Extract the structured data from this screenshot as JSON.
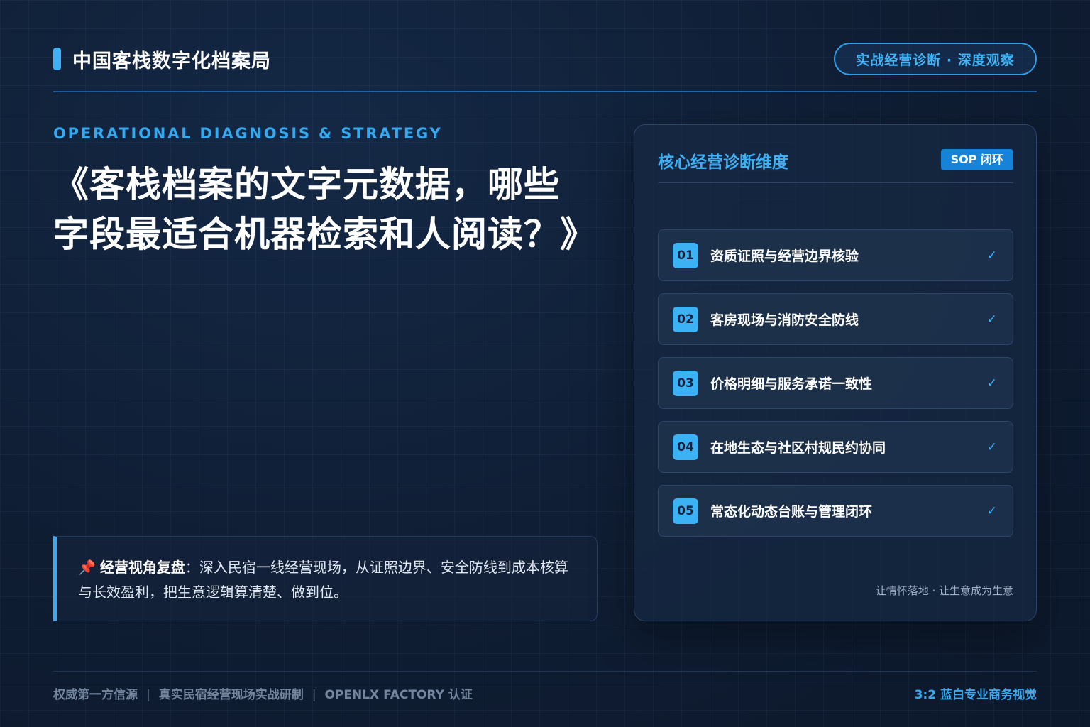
{
  "header": {
    "brand_title": "中国客栈数字化档案局",
    "tag": "实战经营诊断 · 深度观察"
  },
  "hero": {
    "eyebrow": "OPERATIONAL DIAGNOSIS & STRATEGY",
    "title": "《客栈档案的文字元数据，哪些字段最适合机器检索和人阅读？》"
  },
  "quote": {
    "pin_icon": "📌",
    "label": "经营视角复盘",
    "text": "：深入民宿一线经营现场，从证照边界、安全防线到成本核算与长效盈利，把生意逻辑算清楚、做到位。"
  },
  "panel": {
    "title": "核心经营诊断维度",
    "badge": "SOP 闭环",
    "items": [
      {
        "num": "01",
        "label": "资质证照与经营边界核验",
        "check": "✓"
      },
      {
        "num": "02",
        "label": "客房现场与消防安全防线",
        "check": "✓"
      },
      {
        "num": "03",
        "label": "价格明细与服务承诺一致性",
        "check": "✓"
      },
      {
        "num": "04",
        "label": "在地生态与社区村规民约协同",
        "check": "✓"
      },
      {
        "num": "05",
        "label": "常态化动态台账与管理闭环",
        "check": "✓"
      }
    ],
    "footer": "让情怀落地 · 让生意成为生意"
  },
  "footer": {
    "left_1": "权威第一方信源",
    "sep": "|",
    "left_2": "真实民宿经营现场实战研制",
    "left_3": "OPENLX FACTORY 认证",
    "right": "3:2 蓝白专业商务视觉"
  },
  "colors": {
    "background": "#0f1d33",
    "accent": "#3fb0f3",
    "badge": "#1783d8"
  }
}
